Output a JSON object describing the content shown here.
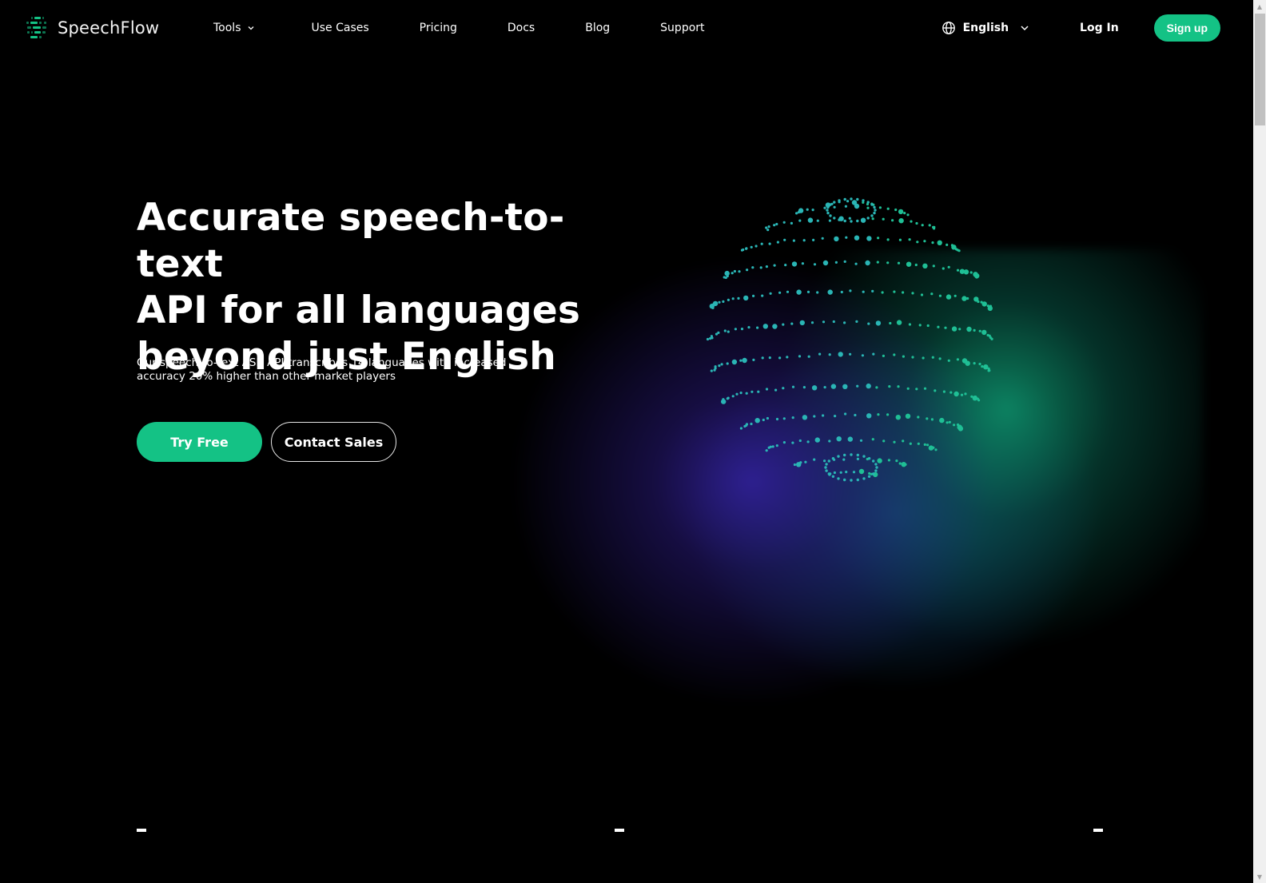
{
  "brand": {
    "name": "SpeechFlow",
    "accent_color": "#14c285"
  },
  "nav": {
    "links": [
      {
        "label": "Tools",
        "has_dropdown": true
      },
      {
        "label": "Use Cases"
      },
      {
        "label": "Pricing"
      },
      {
        "label": "Docs"
      },
      {
        "label": "Blog"
      },
      {
        "label": "Support"
      }
    ],
    "language": {
      "icon": "globe-icon",
      "selected": "English"
    },
    "login_label": "Log In",
    "signup_label": "Sign up"
  },
  "hero": {
    "title_lines": [
      "Accurate speech-to-text",
      "API for all languages",
      "beyond just English"
    ],
    "subtitle_lines": [
      "Our speech-to-text ASR API transcribes 14 languages with increased",
      "accuracy 20% higher than other market players"
    ],
    "primary_cta": "Try Free",
    "secondary_cta": "Contact Sales",
    "illustration": "dotted-globe",
    "glow_colors": [
      "#30209a",
      "#0e966e",
      "#145a96"
    ]
  },
  "scrollbar": {
    "up_glyph": "▲",
    "down_glyph": "▼"
  }
}
